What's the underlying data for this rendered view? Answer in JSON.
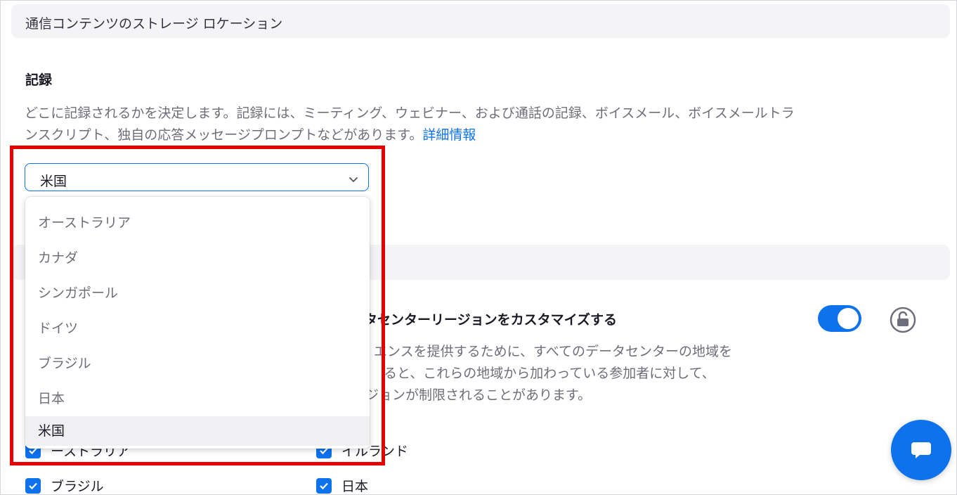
{
  "storage_section": {
    "title": "通信コンテンツのストレージ ロケーション"
  },
  "recording": {
    "title": "記録",
    "description": "どこに記録されるかを決定します。記録には、ミーティング、ウェビナー、および通話の記録、ボイスメール、ボイスメールトランスクリプト、独自の応答メッセージプロンプトなどがあります。",
    "learn_more": "詳細情報",
    "select_value": "米国",
    "options": [
      "オーストラリア",
      "カナダ",
      "シンガポール",
      "ドイツ",
      "ブラジル",
      "日本",
      "米国"
    ]
  },
  "datacenter": {
    "title_partial": "タセンターリージョンをカスタマイズする",
    "desc_line1": "エンスを提供するために、すべてのデータセンターの地域を",
    "desc_line2": "ると、これらの地域から加わっている参加者に対して、",
    "desc_line3": "ジョンが制限されることがあります。",
    "toggle_on": true,
    "checkboxes": {
      "left_partial": "ーストラリア",
      "right_partial": "イルランド",
      "brazil": "ブラジル",
      "japan": "日本"
    }
  },
  "colors": {
    "accent": "#0e72ed",
    "highlight": "#e60000"
  },
  "icons": {
    "chevron": "chevron-down-icon",
    "lock": "lock-icon",
    "chat": "chat-icon",
    "check": "check-icon"
  }
}
